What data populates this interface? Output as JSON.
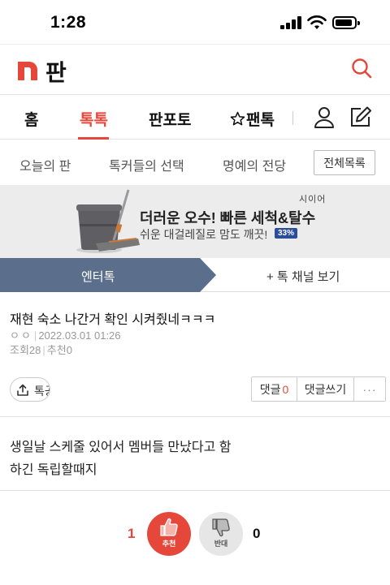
{
  "status_bar": {
    "time": "1:28"
  },
  "header": {
    "title": "판"
  },
  "main_nav": {
    "items": [
      {
        "label": "홈"
      },
      {
        "label": "톡톡"
      },
      {
        "label": "판포토"
      },
      {
        "label": "팬톡"
      }
    ],
    "active": "톡톡"
  },
  "sub_nav": {
    "items": [
      {
        "label": "오늘의 판"
      },
      {
        "label": "톡커들의 선택"
      },
      {
        "label": "명예의 전당"
      }
    ],
    "all_list_label": "전체목록"
  },
  "banner": {
    "brand": "시이어",
    "title": "더러운 오수! 빠른 세척&탈수",
    "subtitle": "쉬운 대걸레질로 맘도 깨끗!",
    "badge": "33%"
  },
  "channel_bar": {
    "current": "엔터톡",
    "more_label": "+ 톡 채널 보기"
  },
  "post": {
    "title": "재현 숙소 나간거 확인 시켜줬네ㅋㅋㅋ",
    "author": "ㅇㅇ",
    "date": "2022.03.01 01:26",
    "views_label": "조회",
    "views": "28",
    "recommend_label": "추천",
    "recommend": "0",
    "share_label": "톡공유",
    "comments_label": "댓글",
    "comments_count": "0",
    "write_comment_label": "댓글쓰기",
    "more_label": "···",
    "body": [
      "생일날 스케줄 있어서 멤버들 만났다고 함",
      "하긴 독립할때지"
    ]
  },
  "vote": {
    "up_count": "1",
    "up_label": "추천",
    "down_count": "0",
    "down_label": "반대"
  },
  "colors": {
    "accent": "#e5483b",
    "channel_tab": "#5b6f8c",
    "banner_bg": "#ececec",
    "badge": "#2a4d9c"
  },
  "icons": [
    "signal-icon",
    "wifi-icon",
    "battery-icon",
    "logo-n-icon",
    "search-icon",
    "star-icon",
    "user-icon",
    "edit-icon",
    "mop-image",
    "share-icon",
    "thumbs-up-icon",
    "thumbs-down-icon"
  ]
}
